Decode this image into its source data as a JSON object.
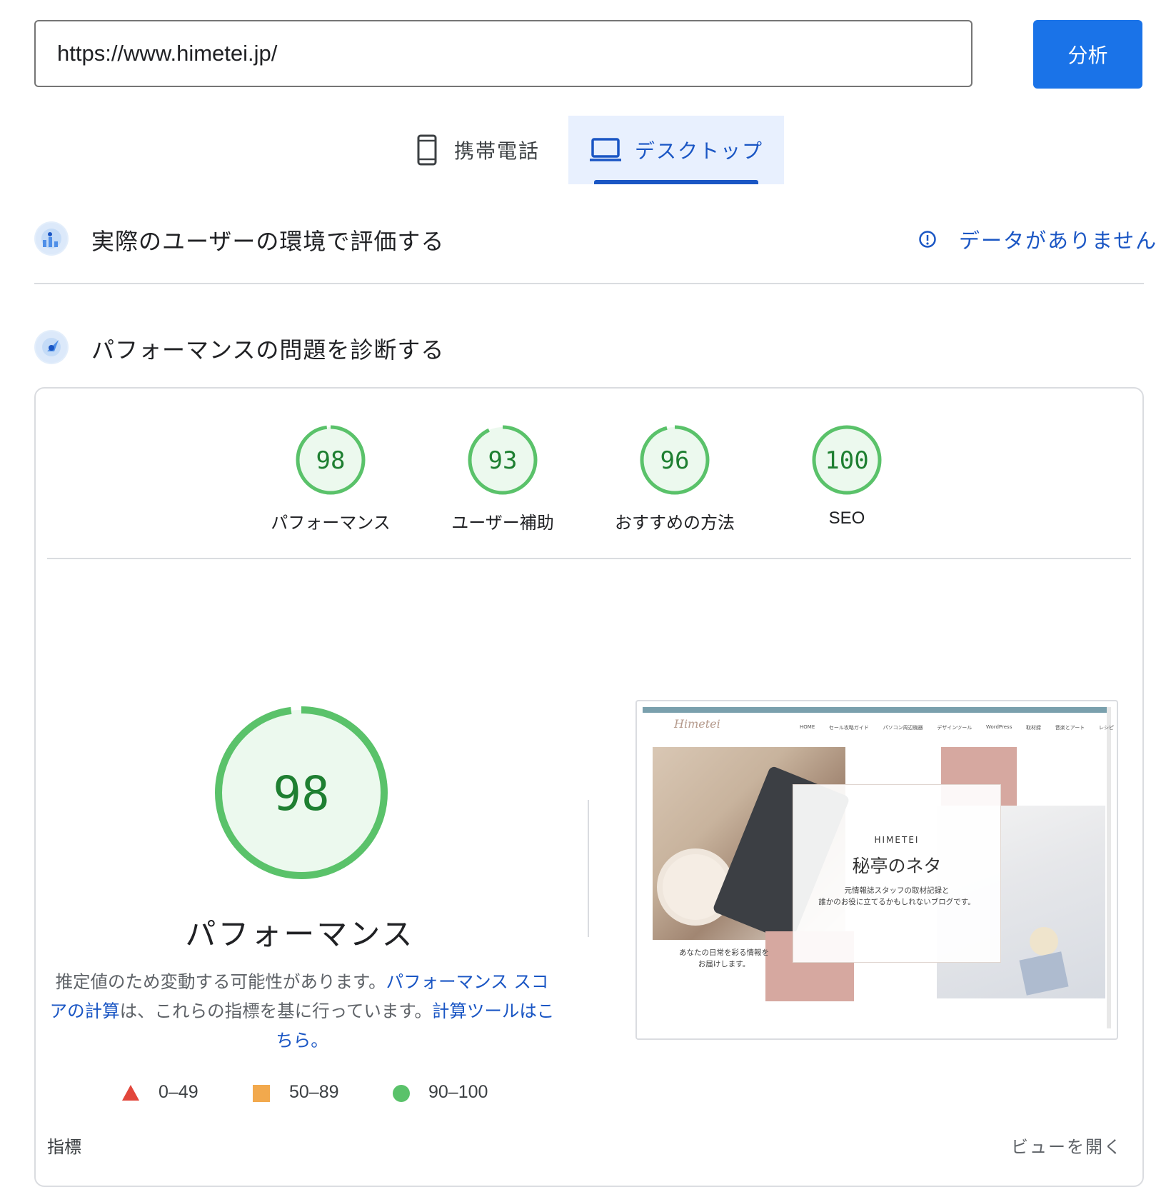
{
  "search": {
    "url": "https://www.himetei.jp/",
    "analyze_label": "分析"
  },
  "tabs": {
    "mobile": "携帯電話",
    "desktop": "デスクトップ"
  },
  "field_data": {
    "title": "実際のユーザーの環境で評価する",
    "status": "データがありません"
  },
  "lab": {
    "title": "パフォーマンスの問題を診断する"
  },
  "scores": [
    {
      "value": "98",
      "label": "パフォーマンス",
      "fraction": 0.98
    },
    {
      "value": "93",
      "label": "ユーザー補助",
      "fraction": 0.93
    },
    {
      "value": "96",
      "label": "おすすめの方法",
      "fraction": 0.96
    },
    {
      "value": "100",
      "label": "SEO",
      "fraction": 1.0
    }
  ],
  "main_score": {
    "value": "98",
    "label": "パフォーマンス",
    "fraction": 0.98
  },
  "description": {
    "text1": "推定値のため変動する可能性があります。",
    "link1": "パフォーマンス スコアの計算",
    "text2": "は、これらの指標を基に行っています。",
    "link2": "計算ツールはこちら。"
  },
  "legend": {
    "fail": "0–49",
    "average": "50–89",
    "pass": "90–100"
  },
  "colors": {
    "pass": "#5ac26a",
    "pass_bg": "#ecf9ee",
    "average": "#f2a94d",
    "fail": "#e2463b",
    "accent": "#1a73e8"
  },
  "metrics": {
    "heading": "指標",
    "expand": "ビューを開く"
  },
  "screenshot": {
    "brand": "HIMETEI",
    "site_title": "秘亭のネタ",
    "tagline_1": "元情報誌スタッフの取材記録と",
    "tagline_2": "誰かのお役に立てるかもしれないブログです。",
    "caption_1": "あなたの日常を彩る情報を",
    "caption_2": "お届けします。",
    "nav": [
      "HOME",
      "セール攻略ガイド",
      "パソコン周辺機器",
      "デザインツール",
      "WordPress",
      "取材録",
      "音楽とアート",
      "レシピ"
    ]
  }
}
